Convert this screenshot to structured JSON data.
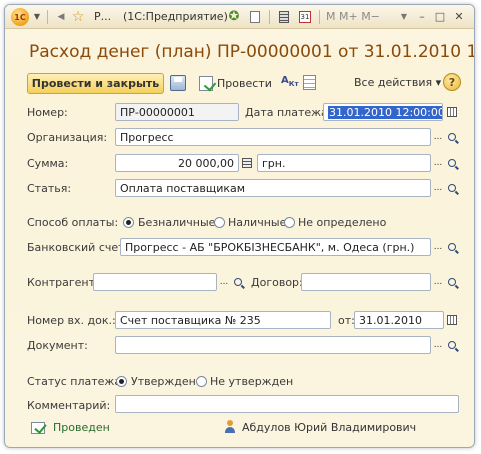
{
  "titlebar": {
    "logo_text": "1С",
    "tab_short": "Р...",
    "app_title": "(1С:Предприятие)",
    "m_buttons": "M  M+  M−",
    "win_controls": [
      "–",
      "□",
      "✕"
    ]
  },
  "document": {
    "title": "Расход денег (план) ПР-00000001 от 31.01.2010 1..."
  },
  "toolbar": {
    "post_and_close": "Провести и закрыть",
    "post": "Провести",
    "all_actions": "Все действия ▾",
    "help": "?"
  },
  "form": {
    "number_label": "Номер:",
    "number_value": "ПР-00000001",
    "payment_date_label": "Дата платежа:",
    "payment_date_value": "31.01.2010 12:00:00",
    "organization_label": "Организация:",
    "organization_value": "Прогресс",
    "sum_label": "Сумма:",
    "sum_value": "20 000,00",
    "currency_value": "грн.",
    "article_label": "Статья:",
    "article_value": "Оплата поставщикам",
    "payment_method_label": "Способ оплаты:",
    "payment_methods": [
      "Безналичные",
      "Наличные",
      "Не определено"
    ],
    "payment_method_selected": "Безналичные",
    "bank_account_label": "Банковский счет:",
    "bank_account_value": "Прогресс - АБ \"БРОКБІЗНЕСБАНК\", м. Одеса (грн.)",
    "counterparty_label": "Контрагент:",
    "counterparty_value": "",
    "contract_label": "Договор:",
    "contract_value": "",
    "incoming_doc_label": "Номер вх. док.:",
    "incoming_doc_value": "Счет поставщика № 235",
    "from_label": "от:",
    "from_value": "31.01.2010",
    "document_label": "Документ:",
    "document_value": "",
    "payment_status_label": "Статус платежа:",
    "payment_statuses": [
      "Утвержден",
      "Не утвержден"
    ],
    "payment_status_selected": "Утвержден",
    "comment_label": "Комментарий:",
    "comment_value": ""
  },
  "status": {
    "posted": "Проведен",
    "author": "Абдулов Юрий Владимирович"
  },
  "icons": {
    "select": "...",
    "search": "search-icon",
    "calendar": "calendar-icon",
    "calc": "calculator-icon"
  }
}
